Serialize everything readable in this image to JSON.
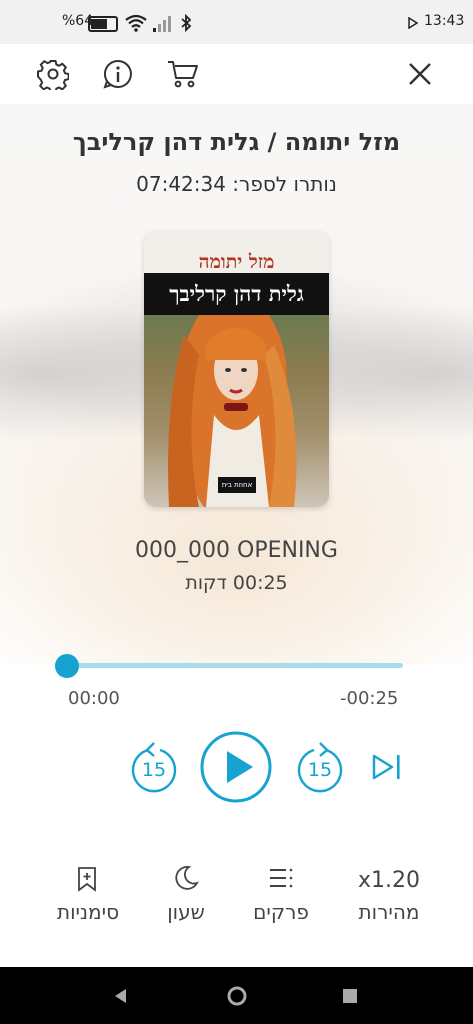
{
  "status_bar": {
    "battery_percent": "%64",
    "time": "13:43"
  },
  "top_bar": {
    "icons": [
      "gear-icon",
      "info-icon",
      "cart-icon",
      "close-icon"
    ]
  },
  "book": {
    "title_author": "מזל יתומה / גלית דהן קרליבך",
    "time_left": "נותרו לספר: 07:42:34",
    "cover": {
      "title": "מזל יתומה",
      "author": "גלית דהן קרליבך",
      "publisher": "אחוזת בית"
    }
  },
  "chapter": {
    "name": "000_000 OPENING",
    "duration": "00:25 דקות"
  },
  "player": {
    "progress": 0.0,
    "elapsed": "00:00",
    "remaining": "-00:25",
    "rewind_seconds": "15",
    "forward_seconds": "15"
  },
  "bottom_nav": {
    "speed_value": "x1.20",
    "speed_label": "מהירות",
    "chapters_label": "פרקים",
    "sleep_label": "שעון",
    "bookmarks_label": "סימניות"
  },
  "colors": {
    "accent": "#16a3cf",
    "track": "#a6dcec"
  }
}
